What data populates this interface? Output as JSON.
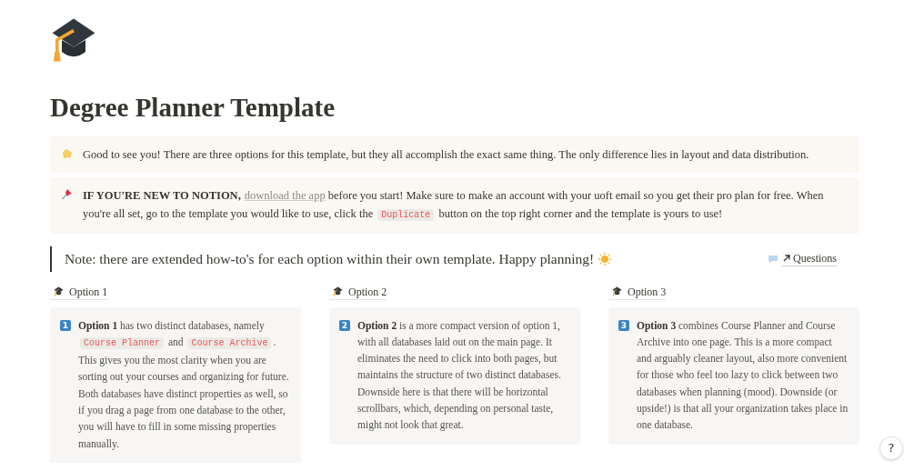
{
  "title": "Degree Planner Template",
  "callouts": [
    {
      "kind": "wave",
      "segments": [
        {
          "kind": "text",
          "text": "Good to see you! There are three options for this template, but they all accomplish the exact same thing. The only difference lies in layout and data distribution."
        }
      ]
    },
    {
      "kind": "pin",
      "segments": [
        {
          "kind": "bold",
          "text": "IF YOU'RE NEW TO NOTION,"
        },
        {
          "kind": "link",
          "text": "download the app"
        },
        {
          "kind": "text",
          "text": " before you start! Make sure to make an account with your uoft email so you get their pro plan for free. When you're all set, go to the template you would like to use, click the "
        },
        {
          "kind": "code",
          "text": "Duplicate"
        },
        {
          "kind": "text",
          "text": " button on the top right corner and the template is yours to use!"
        }
      ]
    }
  ],
  "quote": {
    "text": "Note: there are extended how-to's for each option within their own template. Happy planning!"
  },
  "questions_link": {
    "label": "Questions"
  },
  "options": [
    {
      "label": "Option 1",
      "number": "1",
      "segments": [
        {
          "kind": "bold",
          "text": "Option 1"
        },
        {
          "kind": "text",
          "text": " has two distinct databases, namely "
        },
        {
          "kind": "code",
          "text": "Course Planner"
        },
        {
          "kind": "text",
          "text": " and "
        },
        {
          "kind": "code",
          "text": "Course Archive"
        },
        {
          "kind": "text",
          "text": ". This gives you the most clarity when you are sorting out your courses and organizing for future. Both databases have distinct properties as well, so if you drag a page from one database to the other, you will have to fill in some missing properties manually."
        }
      ]
    },
    {
      "label": "Option 2",
      "number": "2",
      "segments": [
        {
          "kind": "bold",
          "text": "Option 2"
        },
        {
          "kind": "text",
          "text": " is a more compact version of option 1, with all databases laid out on the main page. It eliminates the need to click into both pages, but maintains the structure of two distinct databases. Downside here is that there will be horizontal scrollbars, which, depending on personal taste, might not look that great."
        }
      ]
    },
    {
      "label": "Option 3",
      "number": "3",
      "segments": [
        {
          "kind": "bold",
          "text": "Option 3"
        },
        {
          "kind": "text",
          "text": " combines Course Planner and Course Archive into one page. This is a more compact and arguably cleaner layout, also more convenient for those who feel too lazy to click between two databases when planning (mood). Downside (or upside!) is that all your organization takes place in one database."
        }
      ]
    }
  ],
  "help_button": {
    "label": "?"
  }
}
